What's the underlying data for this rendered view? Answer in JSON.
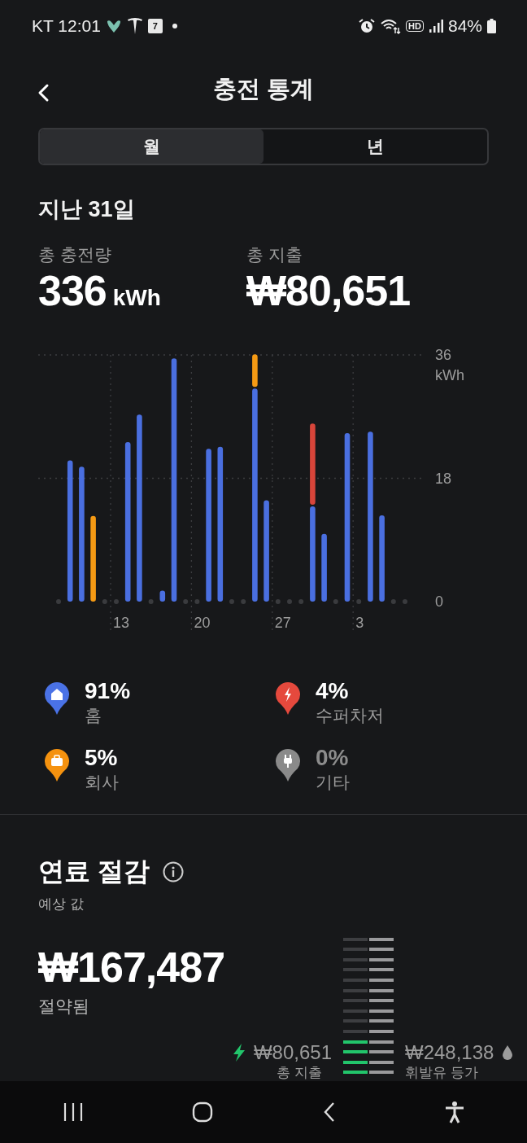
{
  "status_bar": {
    "carrier_time": "KT 12:01",
    "calendar_day": "7",
    "hd_label": "HD",
    "battery": "84%"
  },
  "header": {
    "title": "충전 통계"
  },
  "tabs": [
    {
      "label": "월",
      "selected": true
    },
    {
      "label": "년",
      "selected": false
    }
  ],
  "period": "지난 31일",
  "totals": [
    {
      "label": "총 충전량",
      "value": "336",
      "unit": "kWh"
    },
    {
      "label": "총 지출",
      "value": "₩80,651"
    }
  ],
  "chart": {
    "chart_data": {
      "type": "bar",
      "stacked": true,
      "ylabel": "kWh",
      "grid": true,
      "categories": [
        null,
        null,
        null,
        null,
        null,
        "13",
        null,
        null,
        null,
        null,
        null,
        null,
        "20",
        null,
        null,
        null,
        null,
        null,
        null,
        "27",
        null,
        null,
        null,
        null,
        null,
        null,
        "3",
        null,
        null,
        null,
        null
      ],
      "series": [
        {
          "color": "#4a6fe0",
          "values": [
            0,
            20.6,
            19.7,
            0,
            0,
            0,
            23.3,
            27.3,
            0,
            1.6,
            35.5,
            0,
            0,
            22.3,
            22.6,
            0,
            0,
            31.1,
            14.8,
            0,
            0,
            0,
            13.9,
            9.9,
            0,
            24.6,
            0,
            24.8,
            12.6,
            0,
            0
          ]
        },
        {
          "color": "#f59a14",
          "values": [
            0,
            0,
            0,
            12.5,
            0,
            0,
            0,
            0,
            0,
            0,
            0,
            0,
            0,
            0,
            0,
            0,
            0,
            5.0,
            0,
            0,
            0,
            0,
            0,
            0,
            0,
            0,
            0,
            0,
            0,
            0,
            0
          ]
        },
        {
          "color": "#d8453a",
          "values": [
            0,
            0,
            0,
            0,
            0,
            0,
            0,
            0,
            0,
            0,
            0,
            0,
            0,
            0,
            0,
            0,
            0,
            0,
            0,
            0,
            0,
            0,
            12.1,
            0,
            0,
            0,
            0,
            0,
            0,
            0,
            0
          ]
        }
      ],
      "ylim": [
        0,
        36
      ],
      "yticks": [
        0,
        18,
        {
          "value": 36,
          "label": "36"
        }
      ]
    }
  },
  "legend": [
    {
      "kind": "home",
      "percent": "91%",
      "label": "홈",
      "color": "#4a72e6",
      "inactive": false
    },
    {
      "kind": "supercharger",
      "percent": "4%",
      "label": "수퍼차저",
      "color": "#e5493d",
      "inactive": false
    },
    {
      "kind": "work",
      "percent": "5%",
      "label": "회사",
      "color": "#f5920f",
      "inactive": false
    },
    {
      "kind": "other",
      "percent": "0%",
      "label": "기타",
      "color": "#8a8a8a",
      "inactive": true
    }
  ],
  "fuel_savings": {
    "title": "연료 절감",
    "subtitle": "예상 값",
    "amount": "₩167,487",
    "amount_label": "절약됨",
    "comparison": {
      "level": 0.29,
      "spend": "₩80,651",
      "spend_label": "총 지출",
      "gas": "₩248,138",
      "gas_label": "휘발유 등가"
    }
  }
}
